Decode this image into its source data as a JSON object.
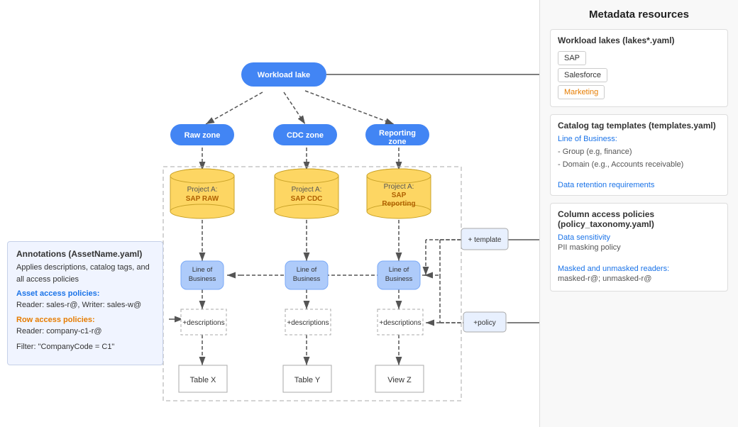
{
  "right_panel": {
    "title": "Metadata resources",
    "sections": [
      {
        "id": "workload-lakes",
        "title": "Workload lakes (lakes*.yaml)",
        "tags": [
          {
            "label": "SAP",
            "style": "sap"
          },
          {
            "label": "Salesforce",
            "style": "salesforce"
          },
          {
            "label": "Marketing",
            "style": "marketing"
          }
        ]
      },
      {
        "id": "catalog-tags",
        "title": "Catalog tag templates (templates.yaml)",
        "link": "Line of Business:",
        "items": [
          "- Group (e.g, finance)",
          "- Domain (e.g., Accounts receivable)"
        ],
        "link2": "Data retention requirements"
      },
      {
        "id": "column-access",
        "title": "Column access policies (policy_taxonomy.yaml)",
        "link": "Data sensitivity",
        "item2": "PII masking policy",
        "link3": "Masked and unmasked readers:",
        "item3": "masked-r@; unmasked-r@"
      }
    ]
  },
  "annotations": {
    "title": "Annotations (AssetName.yaml)",
    "desc": "Applies descriptions, catalog tags, and all access policies",
    "asset_link": "Asset access policies:",
    "asset_sub": "Reader: sales-r@, Writer: sales-w@",
    "row_link": "Row access policies:",
    "row_sub": "Reader: company-c1-r@",
    "filter": "Filter: \"CompanyCode = C1\""
  },
  "diagram": {
    "workload_lake": "Workload lake",
    "raw_zone": "Raw zone",
    "cdc_zone": "CDC zone",
    "reporting_zone": "Reporting zone",
    "project_a_raw": "Project A:\nSAP RAW",
    "project_a_cdc": "Project A:\nSAP CDC",
    "project_a_reporting": "Project A:\nSAP Reporting",
    "line_of_business": "Line of\nBusiness",
    "descriptions": "+descriptions",
    "table_x": "Table X",
    "table_y": "Table Y",
    "view_z": "View Z",
    "template": "+ template",
    "policy": "+policy"
  }
}
